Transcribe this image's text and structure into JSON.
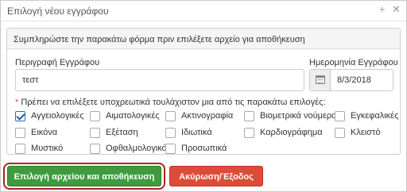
{
  "dialog": {
    "title": "Επιλογή νέου εγγράφου",
    "icons": [
      "plus-icon",
      "close-icon"
    ]
  },
  "panel": {
    "heading": "Συμπληρώστε την παρακάτω φόρμα πριν επιλέξετε αρχείο για αποθήκευση"
  },
  "form": {
    "description_label": "Περιγραφή Εγγράφου",
    "description_value": "τεστ",
    "date_label": "Ημερομηνία Εγγράφου",
    "date_value": "8/3/2018",
    "required_star": "*",
    "required_text": "Πρέπει να επιλέξετε υποχρεωτικά τουλάχιστον μια από τις παρακάτω επιλογές:"
  },
  "checkboxes": [
    {
      "label": "Αγγειολογικές",
      "checked": true
    },
    {
      "label": "Αιματολογικές",
      "checked": false
    },
    {
      "label": "Ακτινογραφία",
      "checked": false
    },
    {
      "label": "Βιομετρικά νούμερα",
      "checked": false
    },
    {
      "label": "Εγκεφαλικές",
      "checked": false
    },
    {
      "label": "Εικόνα",
      "checked": false
    },
    {
      "label": "Εξέταση",
      "checked": false
    },
    {
      "label": "Ιδιωτικά",
      "checked": false
    },
    {
      "label": "Καρδιογράφημα",
      "checked": false
    },
    {
      "label": "Κλειστό",
      "checked": false
    },
    {
      "label": "Μυστικό",
      "checked": false
    },
    {
      "label": "Οφθαλμολογικά",
      "checked": false
    },
    {
      "label": "Προσωπικά",
      "checked": false
    }
  ],
  "buttons": {
    "save_label": "Επιλογή αρχείου και αποθήκευση",
    "cancel_label": "Ακύρωση/Έξοδος"
  },
  "colors": {
    "save": "#3e9b3e",
    "cancel": "#dd4b39",
    "required_star": "#d9534f",
    "focus_ring": "#b22222"
  }
}
